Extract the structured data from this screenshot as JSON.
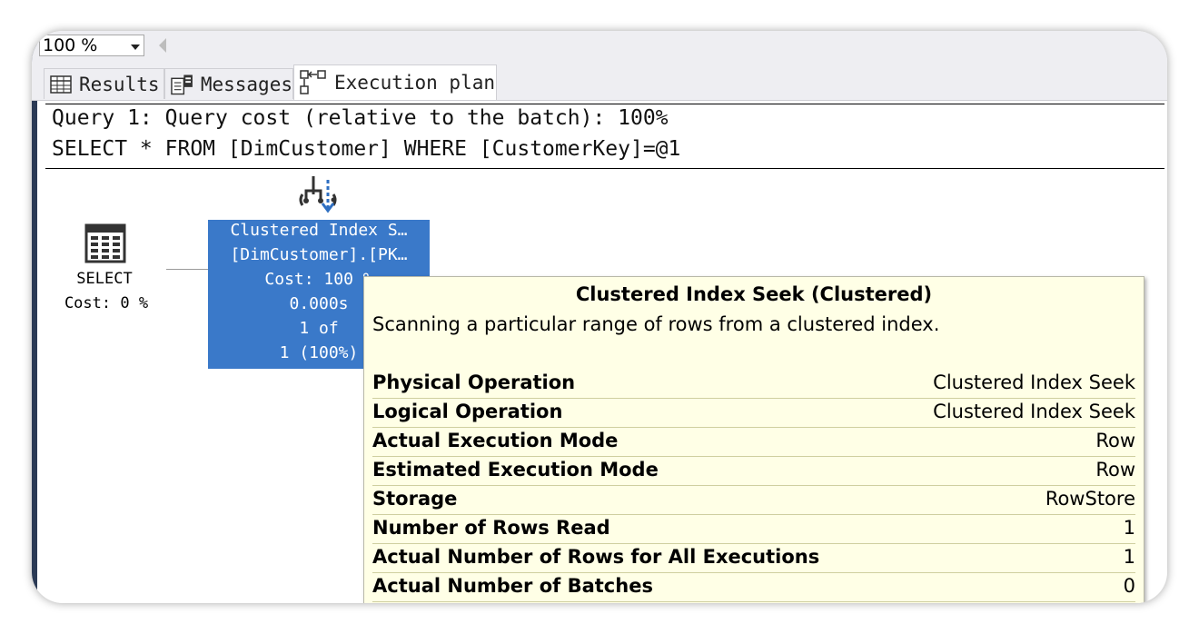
{
  "toolbar": {
    "zoom_value": "100 %"
  },
  "tabs": [
    {
      "label": "Results",
      "icon": "grid-icon",
      "active": false
    },
    {
      "label": "Messages",
      "icon": "messages-icon",
      "active": false
    },
    {
      "label": "Execution plan",
      "icon": "execution-plan-icon",
      "active": true
    }
  ],
  "query": {
    "header": "Query 1: Query cost (relative to the batch): 100%",
    "sql": "SELECT * FROM [DimCustomer] WHERE [CustomerKey]=@1"
  },
  "plan": {
    "select_node": {
      "label": "SELECT",
      "cost": "Cost: 0 %",
      "icon": "select-table-icon"
    },
    "seek_node": {
      "icon": "clustered-index-seek-icon",
      "line1": "Clustered Index S…",
      "line2": "[DimCustomer].[PK…",
      "line3": "Cost: 100 %",
      "line4": "0.000s",
      "line5": "1 of",
      "line6": "1 (100%)",
      "color": "#3a79c9"
    }
  },
  "tooltip": {
    "title": "Clustered Index Seek (Clustered)",
    "description": "Scanning a particular range of rows from a clustered index.",
    "rows": [
      {
        "key": "Physical Operation",
        "value": "Clustered Index Seek"
      },
      {
        "key": "Logical Operation",
        "value": "Clustered Index Seek"
      },
      {
        "key": "Actual Execution Mode",
        "value": "Row"
      },
      {
        "key": "Estimated Execution Mode",
        "value": "Row"
      },
      {
        "key": "Storage",
        "value": "RowStore"
      },
      {
        "key": "Number of Rows Read",
        "value": "1"
      },
      {
        "key": "Actual Number of Rows for All Executions",
        "value": "1"
      },
      {
        "key": "Actual Number of Batches",
        "value": "0"
      }
    ],
    "background": "#ffffe6"
  }
}
